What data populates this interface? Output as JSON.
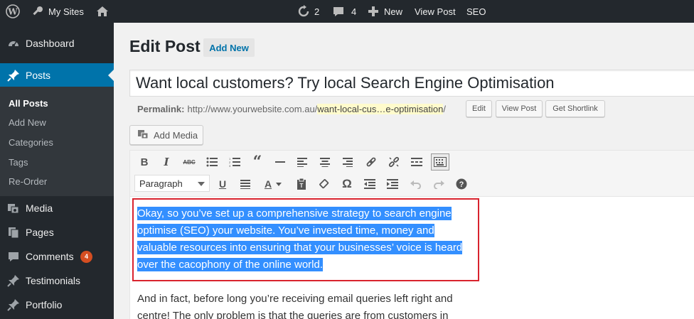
{
  "adminbar": {
    "my_sites": "My Sites",
    "updates_count": "2",
    "comments_count": "4",
    "new_label": "New",
    "view_post": "View Post",
    "seo": "SEO"
  },
  "sidebar": {
    "dashboard": "Dashboard",
    "posts": "Posts",
    "submenu": [
      "All Posts",
      "Add New",
      "Categories",
      "Tags",
      "Re-Order"
    ],
    "media": "Media",
    "pages": "Pages",
    "comments": "Comments",
    "comments_badge": "4",
    "testimonials": "Testimonials",
    "portfolio": "Portfolio"
  },
  "content": {
    "page_title": "Edit Post",
    "add_new": "Add New",
    "post_title": "Want local customers? Try local Search Engine Optimisation",
    "permalink_label": "Permalink:",
    "permalink_base": "http://www.yourwebsite.com.au/",
    "permalink_slug": "want-local-cus…e-optimisation",
    "permalink_trail": "/",
    "edit_btn": "Edit",
    "view_post_btn": "View Post",
    "shortlink_btn": "Get Shortlink",
    "add_media": "Add Media"
  },
  "editor": {
    "format_value": "Paragraph",
    "selected_lines": [
      "Okay, so you’ve set up a comprehensive strategy to search engine",
      "optimise (SEO) your website. You’ve invested time, money and",
      "valuable resources into ensuring that your businesses’ voice is heard",
      "over the cacophony of the online world."
    ],
    "para2_lines": [
      "And in fact, before long you’re receiving email queries left right and",
      "centre! The only problem is that the queries are from customers in"
    ]
  },
  "colors": {
    "adminbar_bg": "#23282d",
    "current_menu": "#0073aa",
    "selection": "#338fff",
    "highlight_border": "#d9232e",
    "badge": "#d54e21"
  }
}
